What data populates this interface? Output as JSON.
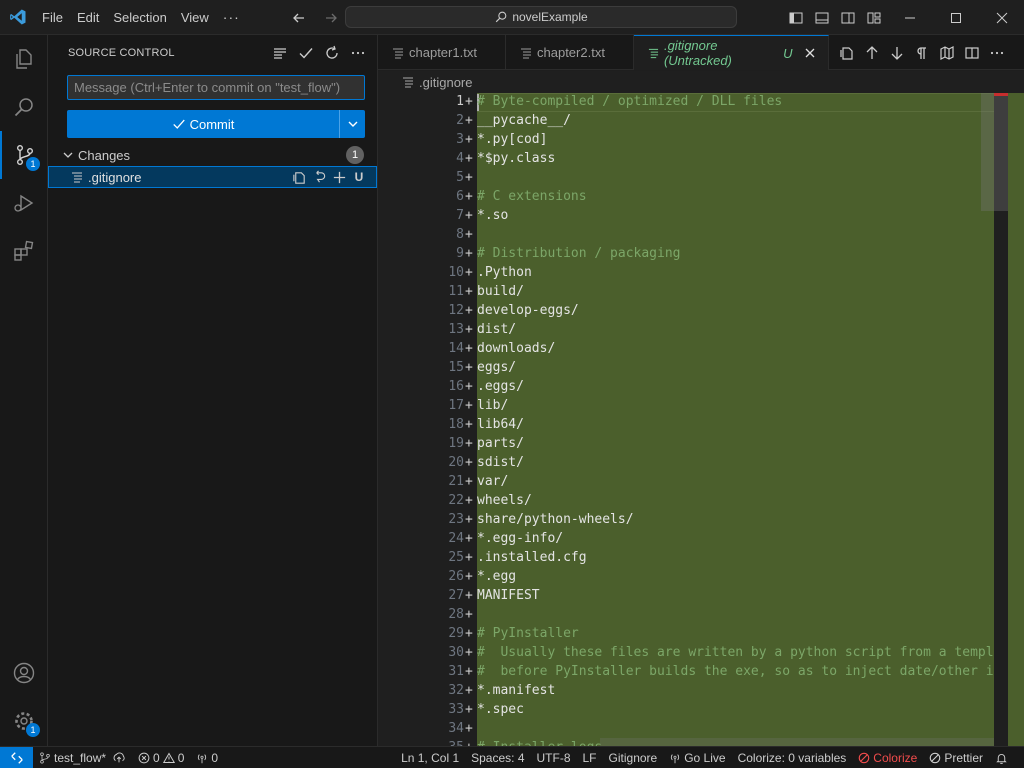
{
  "titlebar": {
    "menus": [
      "File",
      "Edit",
      "Selection",
      "View"
    ],
    "more": "···",
    "search_text": "novelExample"
  },
  "activity": {
    "scm_badge": "1",
    "manage_badge": "1"
  },
  "sidebar": {
    "title": "SOURCE CONTROL",
    "commit_placeholder": "Message (Ctrl+Enter to commit on \"test_flow\")",
    "commit_label": "Commit",
    "changes_label": "Changes",
    "changes_count": "1",
    "file_name": ".gitignore",
    "file_status": "U"
  },
  "tabs": [
    {
      "label": "chapter1.txt"
    },
    {
      "label": "chapter2.txt"
    },
    {
      "label": ".gitignore (Untracked)",
      "status": "U"
    }
  ],
  "breadcrumb": ".gitignore",
  "editor": {
    "active_line": 1,
    "lines": [
      {
        "n": "1",
        "text": "# Byte-compiled / optimized / DLL files",
        "comment": true
      },
      {
        "n": "2",
        "text": "__pycache__/",
        "comment": false
      },
      {
        "n": "3",
        "text": "*.py[cod]",
        "comment": false
      },
      {
        "n": "4",
        "text": "*$py.class",
        "comment": false
      },
      {
        "n": "5",
        "text": "",
        "comment": false
      },
      {
        "n": "6",
        "text": "# C extensions",
        "comment": true
      },
      {
        "n": "7",
        "text": "*.so",
        "comment": false
      },
      {
        "n": "8",
        "text": "",
        "comment": false
      },
      {
        "n": "9",
        "text": "# Distribution / packaging",
        "comment": true
      },
      {
        "n": "10",
        "text": ".Python",
        "comment": false
      },
      {
        "n": "11",
        "text": "build/",
        "comment": false
      },
      {
        "n": "12",
        "text": "develop-eggs/",
        "comment": false
      },
      {
        "n": "13",
        "text": "dist/",
        "comment": false
      },
      {
        "n": "14",
        "text": "downloads/",
        "comment": false
      },
      {
        "n": "15",
        "text": "eggs/",
        "comment": false
      },
      {
        "n": "16",
        "text": ".eggs/",
        "comment": false
      },
      {
        "n": "17",
        "text": "lib/",
        "comment": false
      },
      {
        "n": "18",
        "text": "lib64/",
        "comment": false
      },
      {
        "n": "19",
        "text": "parts/",
        "comment": false
      },
      {
        "n": "20",
        "text": "sdist/",
        "comment": false
      },
      {
        "n": "21",
        "text": "var/",
        "comment": false
      },
      {
        "n": "22",
        "text": "wheels/",
        "comment": false
      },
      {
        "n": "23",
        "text": "share/python-wheels/",
        "comment": false
      },
      {
        "n": "24",
        "text": "*.egg-info/",
        "comment": false
      },
      {
        "n": "25",
        "text": ".installed.cfg",
        "comment": false
      },
      {
        "n": "26",
        "text": "*.egg",
        "comment": false
      },
      {
        "n": "27",
        "text": "MANIFEST",
        "comment": false
      },
      {
        "n": "28",
        "text": "",
        "comment": false
      },
      {
        "n": "29",
        "text": "# PyInstaller",
        "comment": true
      },
      {
        "n": "30",
        "text": "#  Usually these files are written by a python script from a templa",
        "comment": true
      },
      {
        "n": "31",
        "text": "#  before PyInstaller builds the exe, so as to inject date/other in",
        "comment": true
      },
      {
        "n": "32",
        "text": "*.manifest",
        "comment": false
      },
      {
        "n": "33",
        "text": "*.spec",
        "comment": false
      },
      {
        "n": "34",
        "text": "",
        "comment": false
      },
      {
        "n": "35",
        "text": "# Installer logs",
        "comment": true
      }
    ]
  },
  "statusbar": {
    "branch": "test_flow*",
    "errors": "0",
    "warnings": "0",
    "ports": "0",
    "position": "Ln 1, Col 1",
    "spaces": "Spaces: 4",
    "encoding": "UTF-8",
    "eol": "LF",
    "language": "Gitignore",
    "golive": "Go Live",
    "colorize_vars": "Colorize: 0 variables",
    "colorize": "Colorize",
    "prettier": "Prettier"
  },
  "colors": {
    "accent": "#0078d4",
    "added_bg": "#4b5f2c",
    "untracked": "#73c991",
    "error": "#f14c4c"
  }
}
